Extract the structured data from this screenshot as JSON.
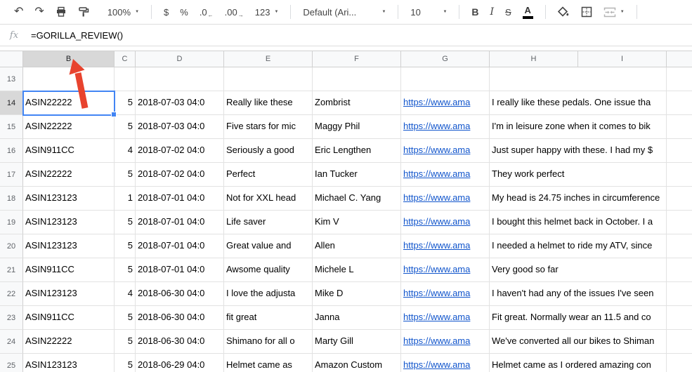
{
  "toolbar": {
    "undo_icon": "↶",
    "redo_icon": "↷",
    "zoom_value": "100%",
    "currency_label": "$",
    "percent_label": "%",
    "decrease_decimal_label": ".0",
    "decrease_decimal_arrow": "←",
    "increase_decimal_label": ".00",
    "increase_decimal_arrow": "→",
    "more_formats_label": "123",
    "font_value": "Default (Ari...",
    "font_size_value": "10",
    "bold_label": "B",
    "italic_label": "I",
    "strikethrough_label": "S",
    "text_color_label": "A",
    "dropdown_caret": "▼"
  },
  "formula_bar": {
    "fx_label": "fx",
    "formula": "=GORILLA_REVIEW()"
  },
  "sheet": {
    "selected_cell": "B14",
    "selected_column": "B",
    "selected_row": "14",
    "column_headers": [
      "B",
      "C",
      "D",
      "E",
      "F",
      "G",
      "H",
      "I"
    ],
    "rows": [
      {
        "num": "13",
        "asin": "",
        "rating": "",
        "date": "",
        "title": "",
        "reviewer": "",
        "url": "",
        "review": ""
      },
      {
        "num": "14",
        "asin": "ASIN22222",
        "rating": "5",
        "date": "2018-07-03 04:0",
        "title": "Really like these",
        "reviewer": "Zombrist",
        "url": "https://www.ama",
        "review": "I really like these pedals. One issue tha"
      },
      {
        "num": "15",
        "asin": "ASIN22222",
        "rating": "5",
        "date": "2018-07-03 04:0",
        "title": "Five stars for mic",
        "reviewer": "Maggy Phil",
        "url": "https://www.ama",
        "review": "I'm in leisure zone when it comes to bik"
      },
      {
        "num": "16",
        "asin": "ASIN911CC",
        "rating": "4",
        "date": "2018-07-02 04:0",
        "title": "Seriously a good",
        "reviewer": "Eric Lengthen",
        "url": "https://www.ama",
        "review": "Just super happy with these. I had my $"
      },
      {
        "num": "17",
        "asin": "ASIN22222",
        "rating": "5",
        "date": "2018-07-02 04:0",
        "title": "Perfect",
        "reviewer": "Ian Tucker",
        "url": "https://www.ama",
        "review": "They work perfect"
      },
      {
        "num": "18",
        "asin": "ASIN123123",
        "rating": "1",
        "date": "2018-07-01 04:0",
        "title": "Not for XXL head",
        "reviewer": "Michael C. Yang",
        "url": "https://www.ama",
        "review": "My head is 24.75 inches in circumference"
      },
      {
        "num": "19",
        "asin": "ASIN123123",
        "rating": "5",
        "date": "2018-07-01 04:0",
        "title": "Life saver",
        "reviewer": "Kim V",
        "url": "https://www.ama",
        "review": "I bought this helmet back in October. I a"
      },
      {
        "num": "20",
        "asin": "ASIN123123",
        "rating": "5",
        "date": "2018-07-01 04:0",
        "title": "Great value and",
        "reviewer": "Allen",
        "url": "https://www.ama",
        "review": "I needed a helmet to ride my ATV, since"
      },
      {
        "num": "21",
        "asin": "ASIN911CC",
        "rating": "5",
        "date": "2018-07-01 04:0",
        "title": "Awsome quality",
        "reviewer": "Michele L",
        "url": "https://www.ama",
        "review": "Very good so far"
      },
      {
        "num": "22",
        "asin": "ASIN123123",
        "rating": "4",
        "date": "2018-06-30 04:0",
        "title": "I love the adjusta",
        "reviewer": "Mike D",
        "url": "https://www.ama",
        "review": "I haven't had any of the issues I've seen"
      },
      {
        "num": "23",
        "asin": "ASIN911CC",
        "rating": "5",
        "date": "2018-06-30 04:0",
        "title": "fit great",
        "reviewer": "Janna",
        "url": "https://www.ama",
        "review": "Fit great. Normally wear an 11.5 and co"
      },
      {
        "num": "24",
        "asin": "ASIN22222",
        "rating": "5",
        "date": "2018-06-30 04:0",
        "title": "Shimano for all o",
        "reviewer": "Marty Gill",
        "url": "https://www.ama",
        "review": "We've converted all our bikes to Shiman"
      },
      {
        "num": "25",
        "asin": "ASIN123123",
        "rating": "5",
        "date": "2018-06-29 04:0",
        "title": "Helmet came as",
        "reviewer": "Amazon Custom",
        "url": "https://www.ama",
        "review": "Helmet came as I ordered amazing con"
      }
    ]
  },
  "annotation": {
    "arrow_color": "#e8432e"
  },
  "colors": {
    "selection_border": "#4285f4",
    "link": "#1155cc",
    "selected_header_bg": "#d8d8d8",
    "header_bg": "#f8f9fa",
    "gridline": "#e2e2e2"
  }
}
